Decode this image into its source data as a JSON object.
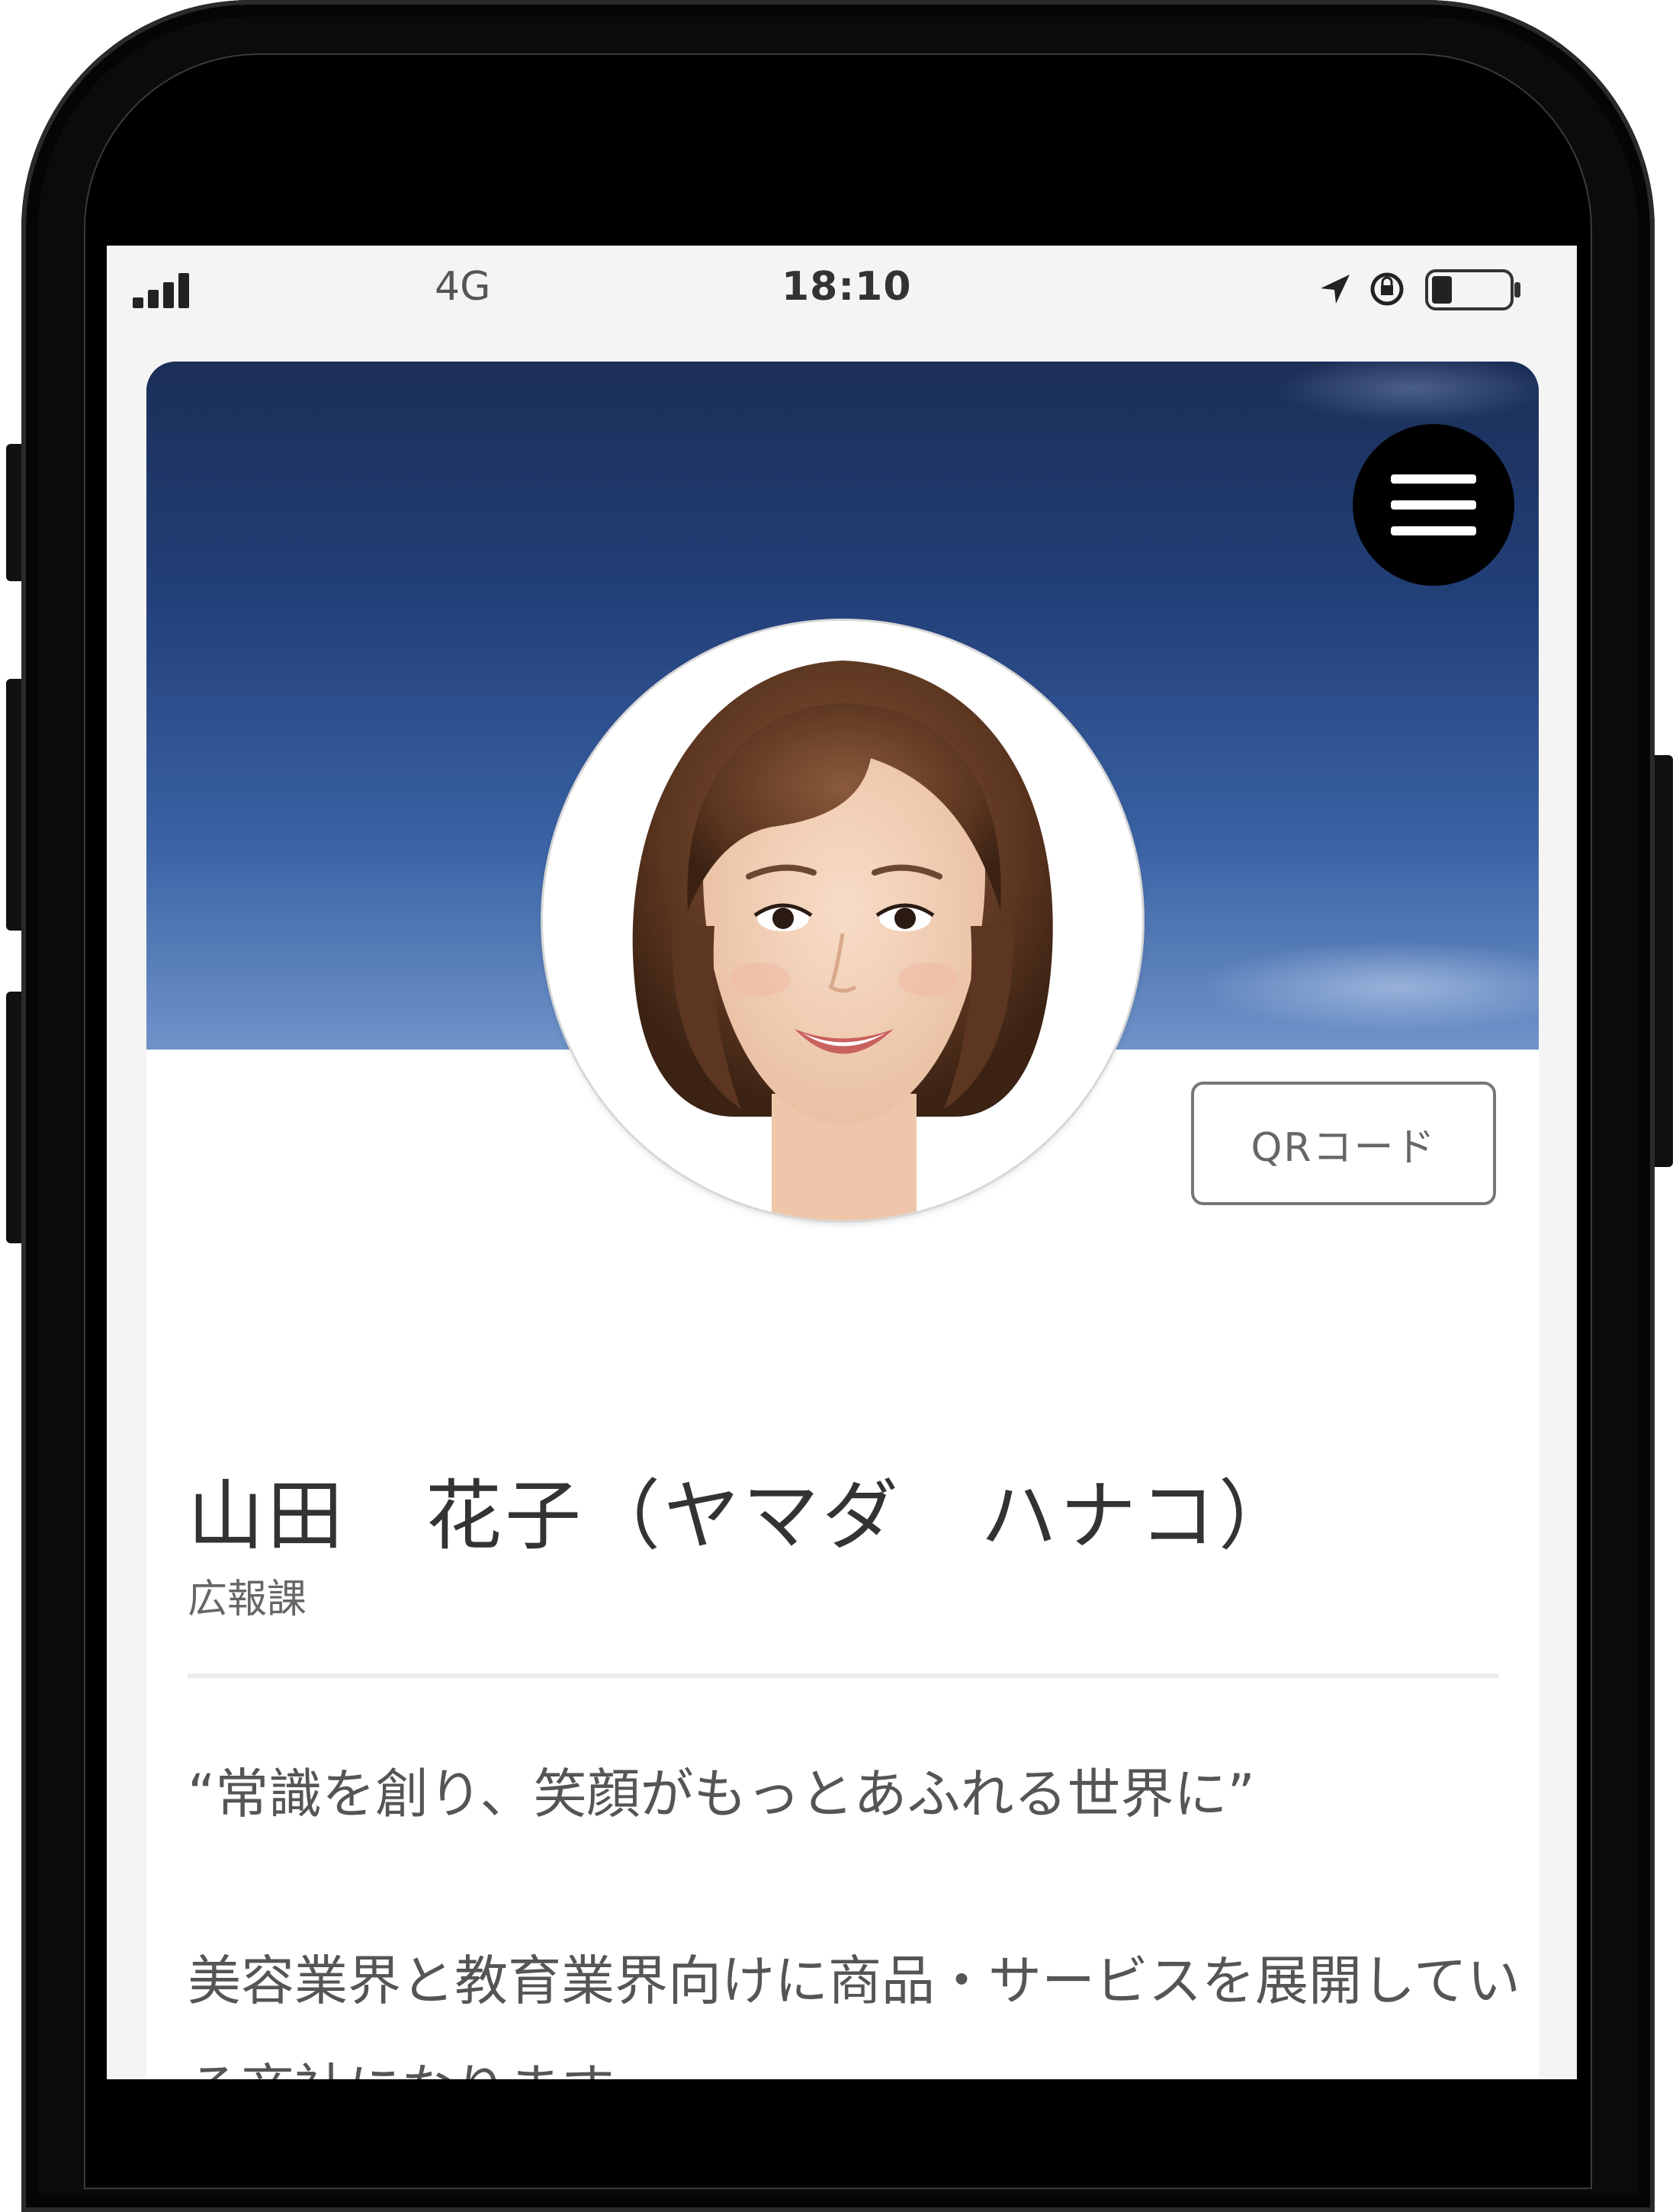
{
  "status_bar": {
    "network": "4G",
    "time": "18:10"
  },
  "profile": {
    "qr_button_label": "QRコード",
    "name": "山田　花子（ヤマダ　ハナコ）",
    "department": "広報課",
    "tagline": "“常識を創り、笑顔がもっとあふれる世界に”",
    "description": "美容業界と教育業界向けに商品・サービスを展開している商社になります。"
  },
  "icons": {
    "signal": "signal-bars-icon",
    "location": "location-arrow-icon",
    "rotation_lock": "rotation-lock-icon",
    "battery": "battery-icon",
    "menu": "hamburger-menu-icon"
  },
  "colors": {
    "cover_top": "#1b2f57",
    "cover_bottom": "#6f93c9",
    "text": "#333333"
  }
}
